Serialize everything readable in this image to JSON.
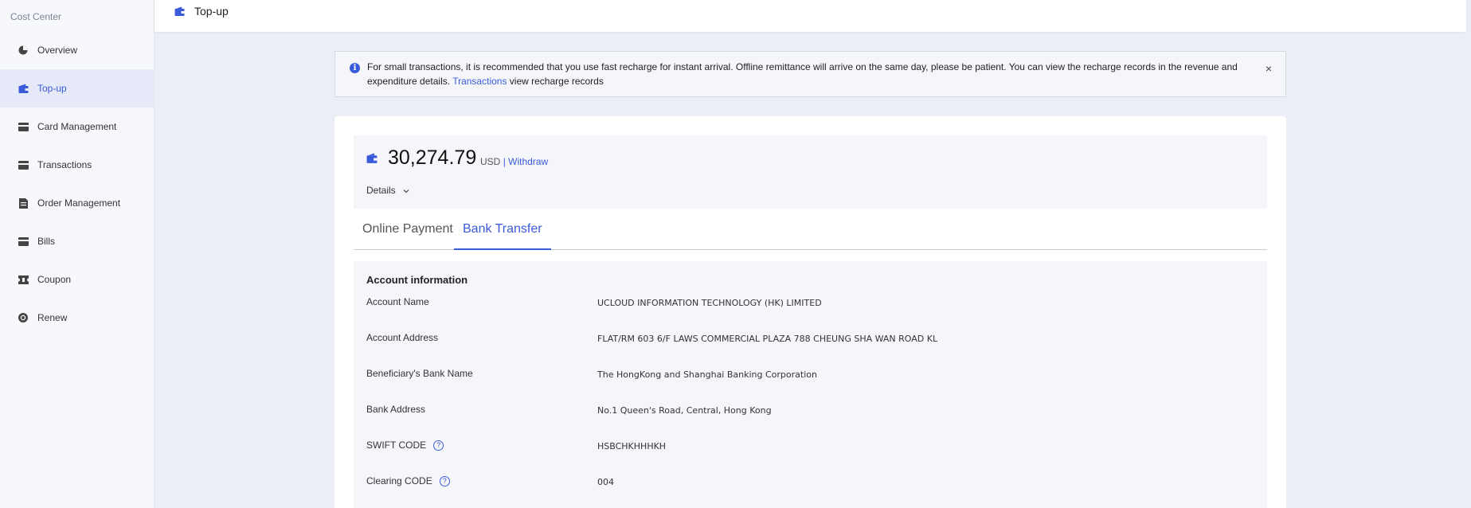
{
  "sidebar": {
    "title": "Cost Center",
    "items": [
      {
        "label": "Overview",
        "icon": "pie-chart-icon"
      },
      {
        "label": "Top-up",
        "icon": "wallet-icon",
        "active": true
      },
      {
        "label": "Card Management",
        "icon": "card-icon"
      },
      {
        "label": "Transactions",
        "icon": "card-icon"
      },
      {
        "label": "Order Management",
        "icon": "document-icon"
      },
      {
        "label": "Bills",
        "icon": "card-icon"
      },
      {
        "label": "Coupon",
        "icon": "ticket-icon"
      },
      {
        "label": "Renew",
        "icon": "renew-icon"
      }
    ]
  },
  "header": {
    "title": "Top-up"
  },
  "notice": {
    "text_before": "For small transactions, it is recommended that you use fast recharge for instant arrival. Offline remittance will arrive on the same day, please be patient. You can view the recharge records in the revenue and expenditure details.",
    "link": "Transactions",
    "text_after": "view recharge records",
    "close": "×"
  },
  "balance": {
    "amount": "30,274.79",
    "currency": "USD",
    "separator": "|",
    "withdraw": "Withdraw",
    "details": "Details"
  },
  "tabs": [
    {
      "label": "Online Payment"
    },
    {
      "label": "Bank Transfer",
      "active": true
    }
  ],
  "account": {
    "heading": "Account information",
    "rows": [
      {
        "key": "Account Name",
        "value": "UCLOUD INFORMATION TECHNOLOGY (HK) LIMITED"
      },
      {
        "key": "Account Address",
        "value": "FLAT/RM 603 6/F LAWS COMMERCIAL PLAZA 788 CHEUNG SHA WAN ROAD KL"
      },
      {
        "key": "Beneficiary's Bank Name",
        "value": "The HongKong and Shanghai Banking Corporation"
      },
      {
        "key": "Bank Address",
        "value": "No.1 Queen's Road, Central, Hong Kong"
      },
      {
        "key": "SWIFT CODE",
        "value": "HSBCHKHHHKH",
        "help": "?"
      },
      {
        "key": "Clearing CODE",
        "value": "004",
        "help": "?"
      }
    ]
  },
  "colors": {
    "accent": "#3a5bd9",
    "background": "#eceef5"
  }
}
